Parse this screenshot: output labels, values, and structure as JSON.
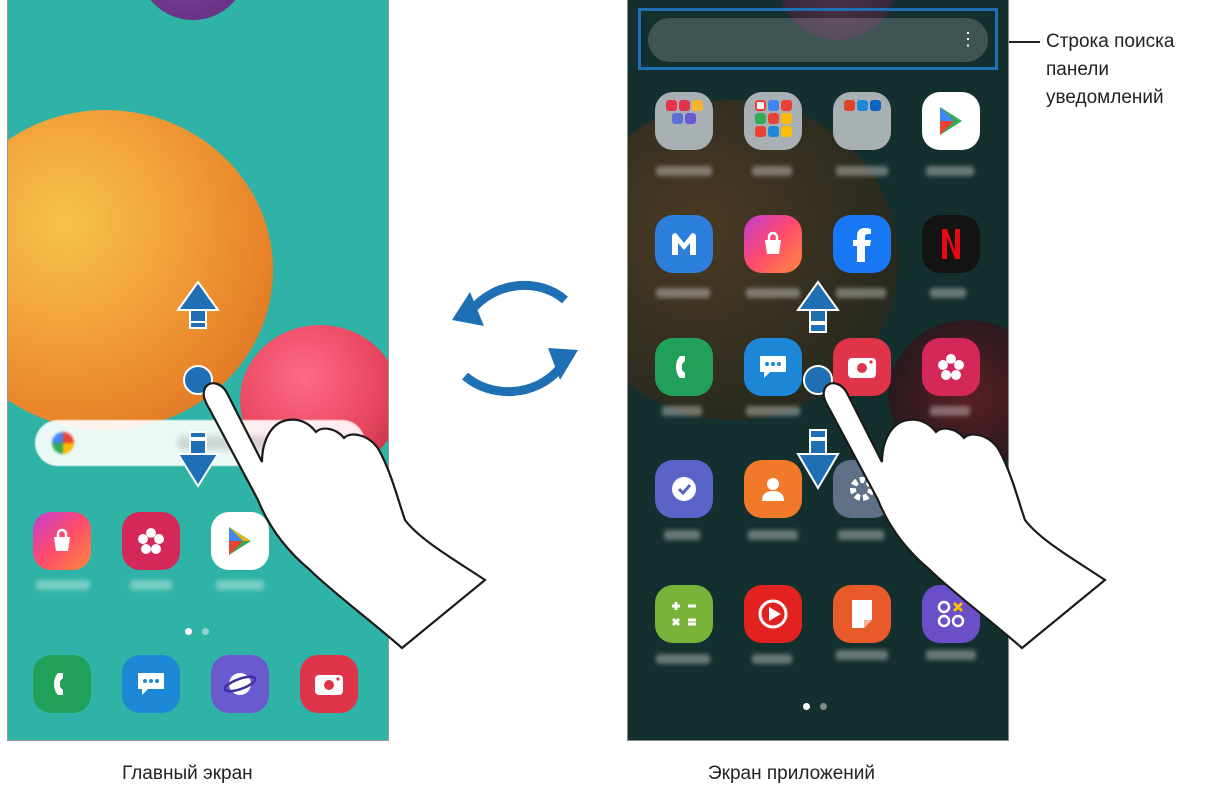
{
  "captions": {
    "home_screen": "Главный экран",
    "apps_screen": "Экран приложений"
  },
  "callout": {
    "line1": "Строка поиска",
    "line2": "панели",
    "line3": "уведомлений"
  },
  "colors": {
    "home_bg": "#2fb3a6",
    "apps_bg": "#14302e",
    "arrow_blue": "#1f6fb4",
    "highlight": "#1f6fb4"
  },
  "home": {
    "apps_row": [
      "galaxy-store-icon",
      "gallery-icon",
      "play-store-icon"
    ],
    "dock": [
      "phone-icon",
      "messages-icon",
      "internet-icon",
      "camera-icon"
    ],
    "page_dots": 2
  },
  "apps": {
    "grid": [
      [
        "samsung-folder-icon",
        "google-folder-icon",
        "microsoft-folder-icon",
        "play-store-icon"
      ],
      [
        "samsung-members-icon",
        "galaxy-store-icon",
        "facebook-icon",
        "netflix-icon"
      ],
      [
        "phone-icon",
        "messages-icon",
        "camera-icon",
        "gallery-icon"
      ],
      [
        "clock-icon",
        "contacts-icon",
        "settings-icon"
      ],
      [
        "calculator-icon",
        "youtube-music-icon",
        "samsung-notes-icon",
        "game-launcher-icon"
      ]
    ],
    "page_dots": 2
  },
  "gestures": {
    "swipe_up_arrow": "arrow-up-icon",
    "swipe_down_arrow": "arrow-down-icon",
    "switch_arrows": "circular-arrows-icon"
  }
}
